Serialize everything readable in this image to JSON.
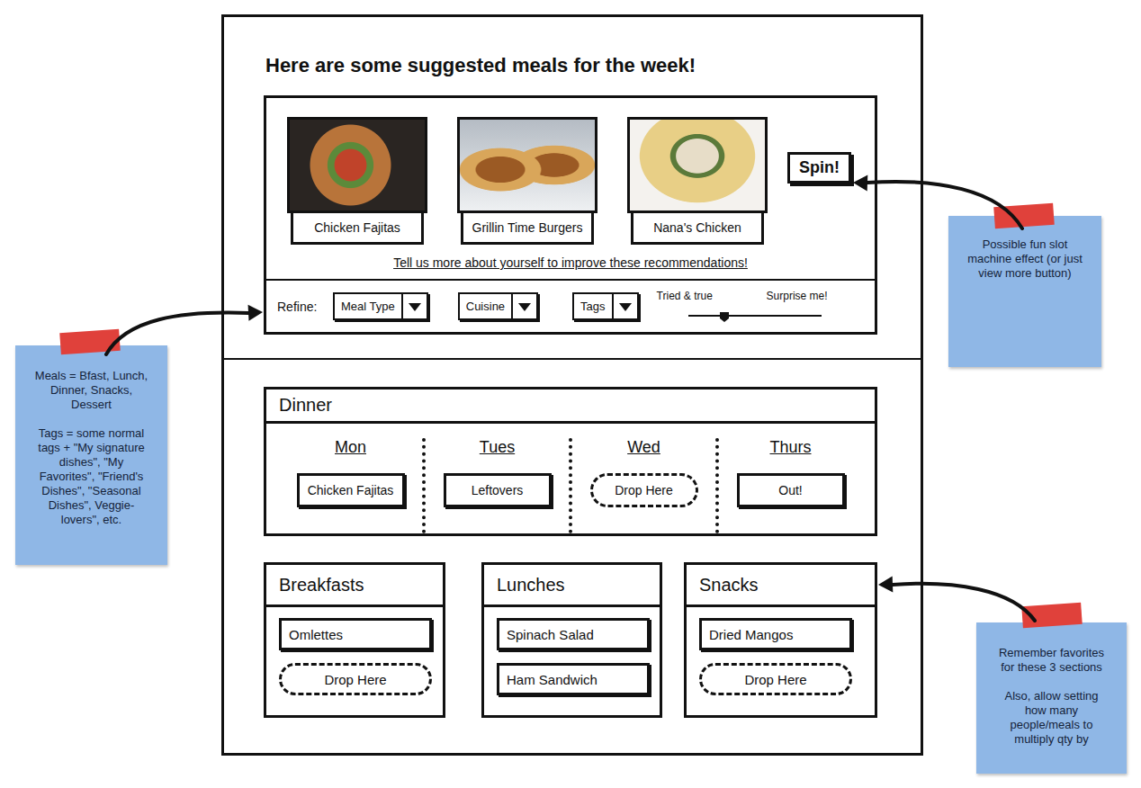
{
  "title": "Here are some suggested meals for the week!",
  "suggestions": [
    {
      "name": "Chicken Fajitas"
    },
    {
      "name": "Grillin Time Burgers"
    },
    {
      "name": "Nana's Chicken"
    }
  ],
  "spin_button": "Spin!",
  "improve_link": "Tell us more about yourself to improve these recommendations!",
  "refine": {
    "label": "Refine:",
    "dropdowns": [
      {
        "label": "Meal Type"
      },
      {
        "label": "Cuisine"
      },
      {
        "label": "Tags"
      }
    ],
    "slider": {
      "min_label": "Tried & true",
      "max_label": "Surprise me!",
      "level": 0.27
    }
  },
  "dinner": {
    "title": "Dinner",
    "days": [
      {
        "day": "Mon",
        "meal": "Chicken Fajitas",
        "kind": "filled"
      },
      {
        "day": "Tues",
        "meal": "Leftovers",
        "kind": "filled"
      },
      {
        "day": "Wed",
        "meal": "Drop Here",
        "kind": "drop"
      },
      {
        "day": "Thurs",
        "meal": "Out!",
        "kind": "filled"
      }
    ]
  },
  "sections": [
    {
      "title": "Breakfasts",
      "items": [
        {
          "label": "Omlettes",
          "kind": "filled"
        },
        {
          "label": "Drop Here",
          "kind": "drop"
        }
      ]
    },
    {
      "title": "Lunches",
      "items": [
        {
          "label": "Spinach Salad",
          "kind": "filled"
        },
        {
          "label": "Ham Sandwich",
          "kind": "filled"
        }
      ]
    },
    {
      "title": "Snacks",
      "items": [
        {
          "label": "Dried Mangos",
          "kind": "filled"
        },
        {
          "label": "Drop Here",
          "kind": "drop"
        }
      ]
    }
  ],
  "notes": [
    {
      "paragraphs": [
        "Meals = Bfast, Lunch, Dinner, Snacks, Dessert",
        "Tags = some normal tags + \"My signature dishes\", \"My Favorites\", \"Friend's Dishes\", \"Seasonal Dishes\", Veggie-lovers\", etc."
      ]
    },
    {
      "paragraphs": [
        "Possible fun slot machine effect (or just view more button)"
      ]
    },
    {
      "paragraphs": [
        "Remember favorites for these 3 sections",
        "Also, allow setting how many people/meals to multiply qty by"
      ]
    }
  ]
}
